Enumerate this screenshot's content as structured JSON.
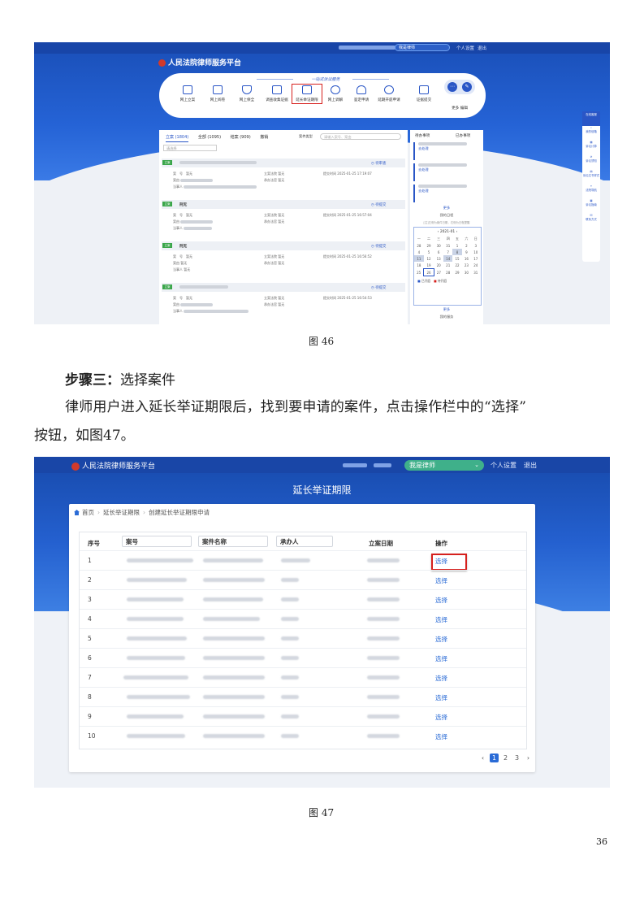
{
  "fig46": {
    "top_links": {
      "settings": "个人设置",
      "logout": "退出"
    },
    "role": "我是律师",
    "brand": "人民法院律师服务平台",
    "services_title": "一站式诉讼服务",
    "services": [
      "网上立案",
      "网上阅卷",
      "网上保全",
      "调查收集证据",
      "延长举证期限",
      "网上调解",
      "鉴定申请",
      "延期开庭申请",
      "证据提交",
      "更多 编辑"
    ],
    "highlight_index": 4,
    "tabs": [
      "立案 (1804)",
      "全部 (1095)",
      "结案 (909)",
      "撤销"
    ],
    "search_placeholder": "请输入案号、案由",
    "filter_label": "案件类型",
    "select_placeholder": "请选择",
    "cards": [
      {
        "tag": "立案",
        "status": "待审查",
        "time": "2025-01-25 17:19:07"
      },
      {
        "tag": "立案",
        "title": "刑无",
        "status": "待提交",
        "time": "2025-01-25 16:57:04"
      },
      {
        "tag": "立案",
        "title": "刑无",
        "status": "待提交",
        "time": "2025-01-25 16:56:52"
      },
      {
        "tag": "立案",
        "status": "待提交",
        "time": "2025-01-25 16:54:53"
      }
    ],
    "card_fields": {
      "case_no": "案　号",
      "cause": "案由",
      "party": "当事人",
      "court": "立案法院",
      "judge": "承办法官",
      "date": "提交时间",
      "dept": "审判庭",
      "value": "暂无"
    },
    "side": {
      "todo": "待办事项",
      "done": "已办事项",
      "more": "更多",
      "calendar_title": "我的日程",
      "calendar_hint": "[注]左侧为案件日期，右侧为日程提醒",
      "month": "2021-01",
      "weekdays": [
        "一",
        "二",
        "三",
        "四",
        "五",
        "六",
        "日"
      ],
      "days": [
        [
          "28",
          "29",
          "30",
          "31",
          "1",
          "2",
          "3"
        ],
        [
          "4",
          "5",
          "6",
          "7",
          "8",
          "9",
          "10"
        ],
        [
          "11",
          "12",
          "13",
          "14",
          "15",
          "16",
          "17"
        ],
        [
          "18",
          "19",
          "20",
          "21",
          "22",
          "23",
          "24"
        ],
        [
          "25",
          "26",
          "27",
          "28",
          "29",
          "30",
          "31"
        ]
      ],
      "legend": [
        "已开庭",
        "待开庭"
      ],
      "my_service": "我的服务",
      "action": "去处理"
    },
    "rail": [
      "在线客服",
      "我的信箱",
      "诉讼计算",
      "诉讼须知",
      "诉讼文书样式",
      "法院导航",
      "诉讼指南",
      "联系方式"
    ]
  },
  "caption46": "图 46",
  "step_heading": {
    "bold": "步骤三：",
    "normal": "选择案件"
  },
  "paragraph_line1": "律师用户进入延长举证期限后，找到要申请的案件，点击操作栏中的“选择”",
  "paragraph_line2": "按钮，如图47。",
  "fig47": {
    "brand": "人民法院律师服务平台",
    "role": "我是律师",
    "top_links": {
      "settings": "个人设置",
      "logout": "退出"
    },
    "page_title": "延长举证期限",
    "breadcrumb": [
      "首页",
      "延长举证期限",
      "创建延长举证期限申请"
    ],
    "columns": [
      "序号",
      "案号",
      "案件名称",
      "承办人",
      "立案日期",
      "操作"
    ],
    "rows": [
      {
        "no": "1",
        "action": "选择"
      },
      {
        "no": "2",
        "action": "选择"
      },
      {
        "no": "3",
        "action": "选择"
      },
      {
        "no": "4",
        "action": "选择"
      },
      {
        "no": "5",
        "action": "选择"
      },
      {
        "no": "6",
        "action": "选择"
      },
      {
        "no": "7",
        "action": "选择"
      },
      {
        "no": "8",
        "action": "选择"
      },
      {
        "no": "9",
        "action": "选择"
      },
      {
        "no": "10",
        "action": "选择"
      }
    ],
    "highlight_row": 1,
    "pagination": {
      "prev": "‹",
      "pages": [
        "1",
        "2",
        "3"
      ],
      "current": "1",
      "next": "›"
    }
  },
  "caption47": "图 47",
  "page_number": "36"
}
